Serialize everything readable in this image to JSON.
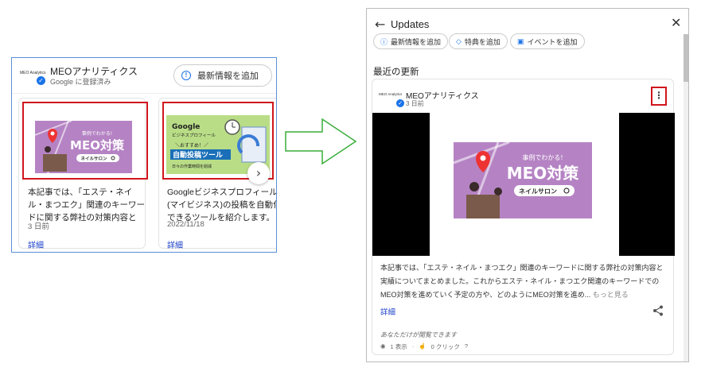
{
  "left": {
    "logo_text": "MEO Analytics",
    "business_name": "MEOアナリティクス",
    "verified_text": "Google に登録済み",
    "add_button_label": "最新情報を追加",
    "cards": [
      {
        "banner": {
          "top": "事例でわかる!",
          "main": "MEO対策",
          "sub": "ネイルサロン"
        },
        "text": "本記事では、「エステ・ネイル・まつエク」関連のキーワードに関する弊社の対策内容と",
        "date": "3 日前",
        "link": "詳細"
      },
      {
        "banner": {
          "top": "Google",
          "line2": "ビジネスプロフィール",
          "line3": "＼おすすめ！／",
          "main": "自動投稿ツール",
          "sub": "日々の作業時間を削減"
        },
        "text": "Googleビジネスプロフィール(マイビジネス)の投稿を自動化できるツールを紹介します。",
        "date": "2022/11/18",
        "link": "詳細"
      }
    ]
  },
  "right": {
    "title": "Updates",
    "chips": [
      "最新情報を追加",
      "特典を追加",
      "イベントを追加"
    ],
    "section_title": "最近の更新",
    "post": {
      "logo_text": "MEO Analytics",
      "business_name": "MEOアナリティクス",
      "time": "3 日前",
      "banner": {
        "top": "事例でわかる!",
        "main": "MEO対策",
        "sub": "ネイルサロン"
      },
      "body": "本記事では、「エステ・ネイル・まつエク」関連のキーワードに関する弊社の対策内容と実績についてまとめました。これからエステ・ネイル・まつエク関連のキーワードでのMEO対策を進めていく予定の方や、どのようにMEO対策を進め...",
      "more_label": "もっと見る",
      "detail_label": "詳細",
      "visibility_note": "あなただけが閲覧できます",
      "views": "1 表示",
      "clicks": "0 クリック"
    }
  },
  "colors": {
    "accent": "#1a73e8",
    "highlight": "#d0161c",
    "arrow": "#3aae3a",
    "banner_bg": "#b583c4"
  }
}
